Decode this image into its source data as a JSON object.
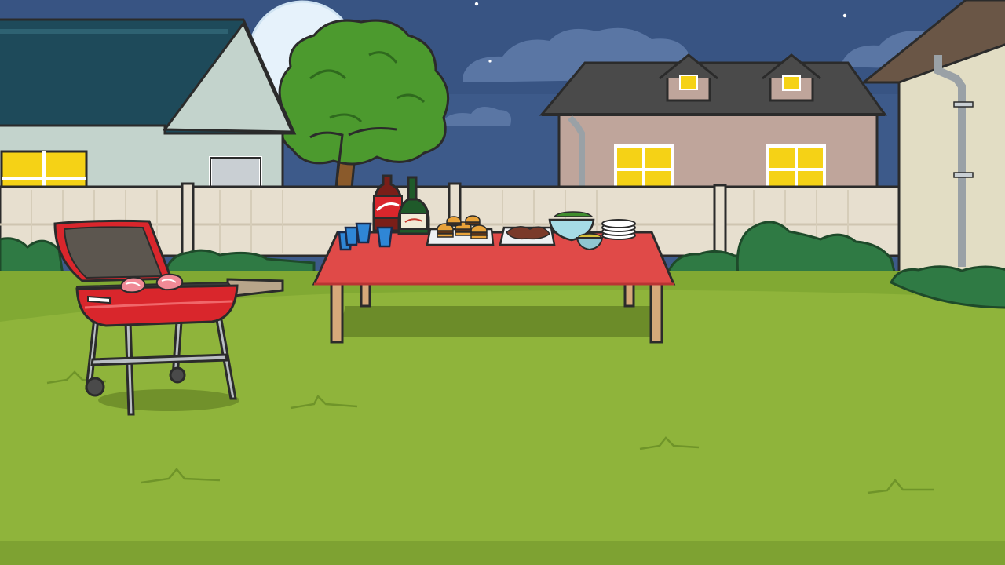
{
  "scene": {
    "description_tags": [
      "backyard",
      "night",
      "barbecue",
      "cartoon"
    ],
    "time_of_day": "night",
    "colors": {
      "sky": "#3d5a8a",
      "sky_dark": "#2f4a78",
      "moon": "#e6f2fb",
      "cloud": "#5a76a4",
      "grass": "#8fb43b",
      "grass_dark": "#78a12f",
      "fence": "#e7dfcf",
      "fence_line": "#cfc5b1",
      "tablecloth": "#e04a48",
      "grill_red": "#d9262c",
      "window": "#f5d216",
      "bush": "#2f7a44",
      "tree": "#4c9a2e"
    },
    "objects": [
      {
        "name": "moon"
      },
      {
        "name": "tree"
      },
      {
        "name": "house-left"
      },
      {
        "name": "house-center"
      },
      {
        "name": "house-right"
      },
      {
        "name": "fence"
      },
      {
        "name": "grill",
        "items": [
          "steak",
          "steak"
        ]
      },
      {
        "name": "food-table",
        "items": [
          "cola-bottle",
          "wine-bottle",
          "blue-cups",
          "burger-tray",
          "meat-tray",
          "salad-bowl",
          "snack-bowl",
          "plate-stack"
        ]
      }
    ]
  }
}
